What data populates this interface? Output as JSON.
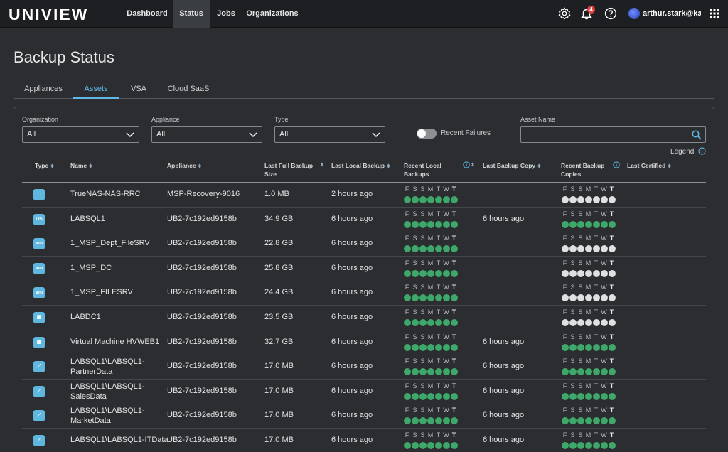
{
  "app": {
    "logo": "UNIVIEW",
    "nav": [
      "Dashboard",
      "Status",
      "Jobs",
      "Organizations"
    ],
    "active_nav": "Status",
    "notification_count": "4",
    "user": "arthur.stark@ka..."
  },
  "page": {
    "title": "Backup Status",
    "tabs": [
      "Appliances",
      "Assets",
      "VSA",
      "Cloud SaaS"
    ],
    "active_tab": "Assets"
  },
  "filters": {
    "organization_label": "Organization",
    "organization_value": "All",
    "appliance_label": "Appliance",
    "appliance_value": "All",
    "type_label": "Type",
    "type_value": "All",
    "recent_failures_label": "Recent Failures",
    "asset_name_label": "Asset Name",
    "legend_label": "Legend"
  },
  "table": {
    "headers": {
      "type": "Type",
      "name": "Name",
      "appliance": "Appliance",
      "last_full_1": "Last Full Backup",
      "last_full_2": "Size",
      "last_local": "Last Local Backup",
      "recent_local_1": "Recent Local",
      "recent_local_2": "Backups",
      "last_copy": "Last Backup Copy",
      "recent_copies_1": "Recent Backup",
      "recent_copies_2": "Copies",
      "last_certified": "Last Certified"
    },
    "day_letters": [
      "F",
      "S",
      "S",
      "M",
      "T",
      "W",
      "T"
    ],
    "rows": [
      {
        "icon": "nas-icon",
        "icon_text": "",
        "name1": "TrueNAS-NAS-RRC",
        "name2": "",
        "appliance": "MSP-Recovery-9016",
        "size": "1.0 MB",
        "last_local": "2 hours ago",
        "local": "ggggggg",
        "last_copy": "",
        "copies": "wwwwwww"
      },
      {
        "icon": "database-icon",
        "icon_text": "DS",
        "name1": "LABSQL1",
        "name2": "",
        "appliance": "UB2-7c192ed9158b",
        "size": "34.9 GB",
        "last_local": "6 hours ago",
        "local": "ggggggg",
        "last_copy": "6 hours ago",
        "copies": "ggggggg"
      },
      {
        "icon": "vm-icon",
        "icon_text": "vm",
        "name1": "1_MSP_Dept_FileSRV",
        "name2": "",
        "appliance": "UB2-7c192ed9158b",
        "size": "22.8 GB",
        "last_local": "6 hours ago",
        "local": "ggggggg",
        "last_copy": "",
        "copies": "wwwwwww"
      },
      {
        "icon": "vm-icon",
        "icon_text": "vm",
        "name1": "1_MSP_DC",
        "name2": "",
        "appliance": "UB2-7c192ed9158b",
        "size": "25.8 GB",
        "last_local": "6 hours ago",
        "local": "ggggggg",
        "last_copy": "",
        "copies": "wwwwwww"
      },
      {
        "icon": "vm-icon",
        "icon_text": "vm",
        "name1": "1_MSP_FILESRV",
        "name2": "",
        "appliance": "UB2-7c192ed9158b",
        "size": "24.4 GB",
        "last_local": "6 hours ago",
        "local": "ggggggg",
        "last_copy": "",
        "copies": "wwwwwww"
      },
      {
        "icon": "windows-icon",
        "icon_text": "▦",
        "name1": "LABDC1",
        "name2": "",
        "appliance": "UB2-7c192ed9158b",
        "size": "23.5 GB",
        "last_local": "6 hours ago",
        "local": "ggggggg",
        "last_copy": "",
        "copies": "wwwwwww"
      },
      {
        "icon": "hyperv-icon",
        "icon_text": "▦",
        "name1": "Virtual Machine HVWEB1",
        "name2": "",
        "appliance": "UB2-7c192ed9158b",
        "size": "32.7 GB",
        "last_local": "6 hours ago",
        "local": "ggggggg",
        "last_copy": "6 hours ago",
        "copies": "ggggggg"
      },
      {
        "icon": "sql-icon",
        "icon_text": "⟋",
        "name1": "LABSQL1\\LABSQL1-",
        "name2": "PartnerData",
        "appliance": "UB2-7c192ed9158b",
        "size": "17.0 MB",
        "last_local": "6 hours ago",
        "local": "ggggggg",
        "last_copy": "6 hours ago",
        "copies": "ggggggg"
      },
      {
        "icon": "sql-icon",
        "icon_text": "⟋",
        "name1": "LABSQL1\\LABSQL1-",
        "name2": "SalesData",
        "appliance": "UB2-7c192ed9158b",
        "size": "17.0 MB",
        "last_local": "6 hours ago",
        "local": "ggggggg",
        "last_copy": "6 hours ago",
        "copies": "ggggggg"
      },
      {
        "icon": "sql-icon",
        "icon_text": "⟋",
        "name1": "LABSQL1\\LABSQL1-",
        "name2": "MarketData",
        "appliance": "UB2-7c192ed9158b",
        "size": "17.0 MB",
        "last_local": "6 hours ago",
        "local": "ggggggg",
        "last_copy": "6 hours ago",
        "copies": "ggggggg"
      },
      {
        "icon": "sql-icon",
        "icon_text": "⟋",
        "name1": "LABSQL1\\LABSQL1-ITData",
        "name2": "",
        "appliance": "UB2-7c192ed9158b",
        "size": "17.0 MB",
        "last_local": "6 hours ago",
        "local": "ggggggg",
        "last_copy": "6 hours ago",
        "copies": "ggggggg"
      }
    ]
  }
}
